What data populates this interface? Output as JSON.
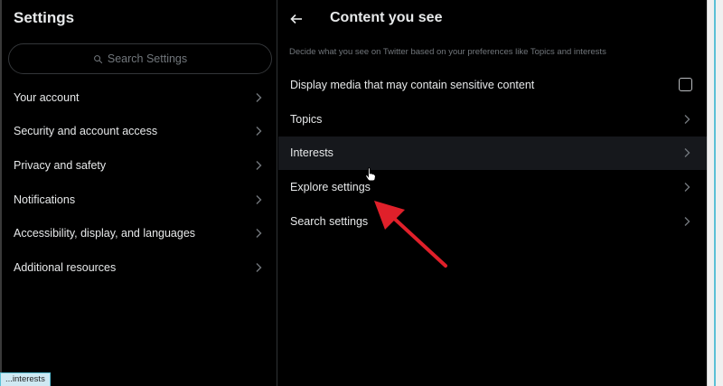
{
  "left": {
    "title": "Settings",
    "search": {
      "placeholder": "Search Settings",
      "icon": "search-icon"
    },
    "items": [
      {
        "label": "Your account"
      },
      {
        "label": "Security and account access"
      },
      {
        "label": "Privacy and safety"
      },
      {
        "label": "Notifications"
      },
      {
        "label": "Accessibility, display, and languages"
      },
      {
        "label": "Additional resources"
      }
    ]
  },
  "right": {
    "title": "Content you see",
    "description": "Decide what you see on Twitter based on your preferences like Topics and interests",
    "rows": [
      {
        "label": "Display media that may contain sensitive content",
        "control": "checkbox",
        "checked": false
      },
      {
        "label": "Topics",
        "control": "chevron"
      },
      {
        "label": "Interests",
        "control": "chevron",
        "hovered": true
      },
      {
        "label": "Explore settings",
        "control": "chevron"
      },
      {
        "label": "Search settings",
        "control": "chevron"
      }
    ]
  },
  "status_bar": {
    "text": "...interests"
  },
  "colors": {
    "background": "#000000",
    "text": "#e7e9ea",
    "muted": "#71767b",
    "hover_row": "#16181c",
    "annotation_arrow": "#e0202a"
  }
}
